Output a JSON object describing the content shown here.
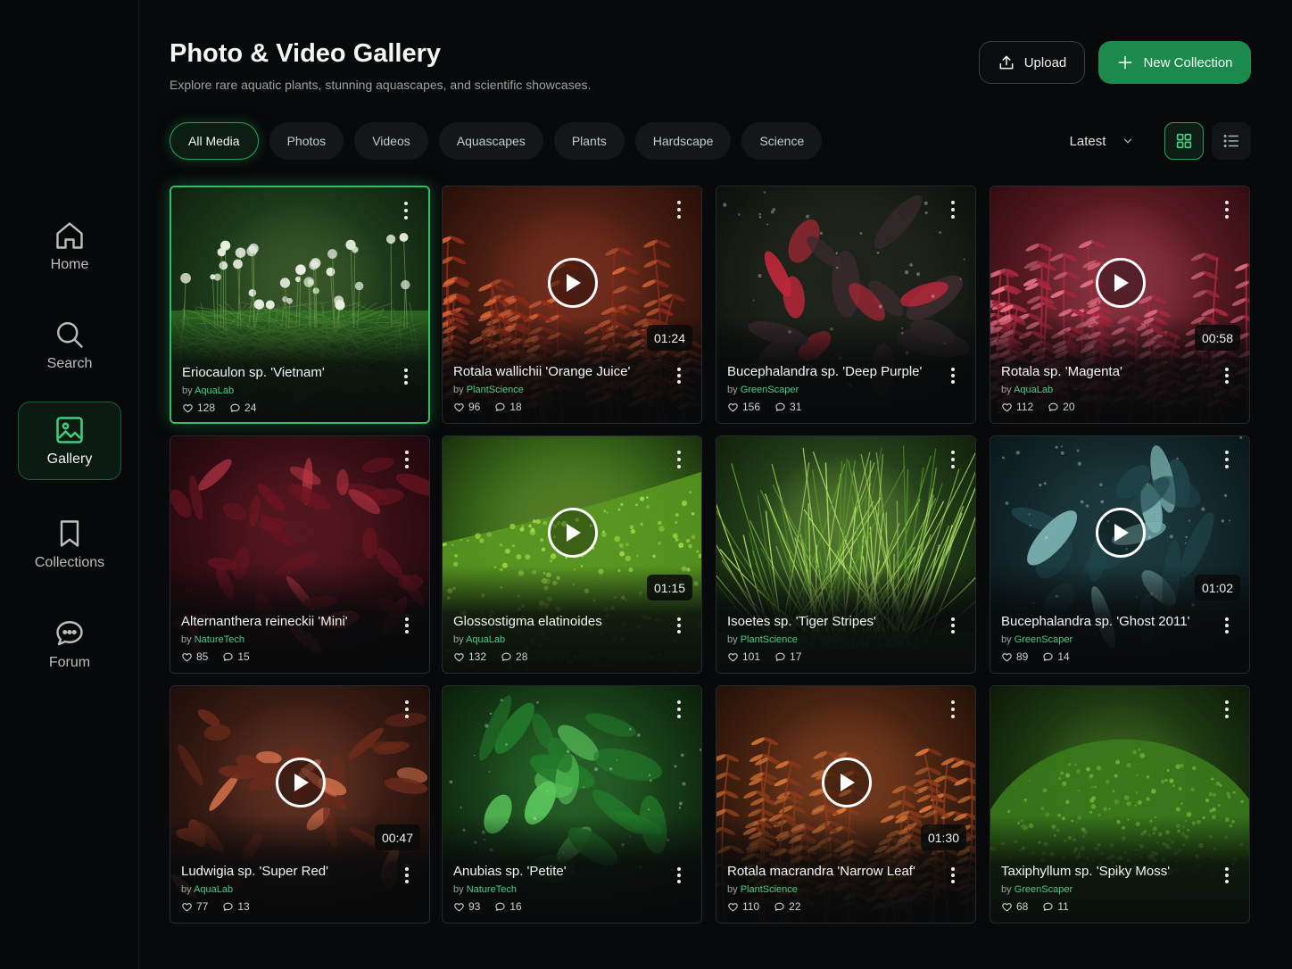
{
  "nav": [
    {
      "label": "Home",
      "icon": "home-icon"
    },
    {
      "label": "Search",
      "icon": "search-icon"
    },
    {
      "label": "Gallery",
      "icon": "image-icon",
      "active": true
    },
    {
      "label": "Collections",
      "icon": "bookmark-icon"
    },
    {
      "label": "Forum",
      "icon": "chat-icon"
    }
  ],
  "header": {
    "title": "Photo & Video Gallery",
    "subtitle": "Explore rare aquatic plants, stunning aquascapes, and scientific showcases.",
    "upload_label": "Upload",
    "new_collection_label": "New Collection"
  },
  "filters": [
    "All Media",
    "Photos",
    "Videos",
    "Aquascapes",
    "Plants",
    "Hardscape",
    "Science"
  ],
  "active_filter": "All Media",
  "sort": {
    "selected": "Latest"
  },
  "view": {
    "selected": "grid"
  },
  "colors": {
    "accent": "#1c8a4c",
    "accent_bright": "#2fc06b",
    "background": "#07090a"
  },
  "items": [
    {
      "title": "Eriocaulon sp. 'Vietnam'",
      "by": "by",
      "author": "AquaLab",
      "likes": "128",
      "comments": "24",
      "video": false,
      "duration": "",
      "selected": true,
      "theme": "eriocaulon"
    },
    {
      "title": "Rotala wallichii 'Orange Juice'",
      "by": "by",
      "author": "PlantScience",
      "likes": "96",
      "comments": "18",
      "video": true,
      "duration": "01:24",
      "theme": "red-stems"
    },
    {
      "title": "Bucephalandra sp. 'Deep Purple'",
      "by": "by",
      "author": "GreenScaper",
      "likes": "156",
      "comments": "31",
      "video": false,
      "duration": "",
      "theme": "buce-dark"
    },
    {
      "title": "Rotala sp. 'Magenta'",
      "by": "by",
      "author": "AquaLab",
      "likes": "112",
      "comments": "20",
      "video": true,
      "duration": "00:58",
      "theme": "magenta"
    },
    {
      "title": "Alternanthera reineckii 'Mini'",
      "by": "by",
      "author": "NatureTech",
      "likes": "85",
      "comments": "15",
      "video": false,
      "duration": "",
      "theme": "alternanthera"
    },
    {
      "title": "Glossostigma elatinoides",
      "by": "by",
      "author": "AquaLab",
      "likes": "132",
      "comments": "28",
      "video": true,
      "duration": "01:15",
      "theme": "carpet"
    },
    {
      "title": "Isoetes sp. 'Tiger Stripes'",
      "by": "by",
      "author": "PlantScience",
      "likes": "101",
      "comments": "17",
      "video": false,
      "duration": "",
      "theme": "grass"
    },
    {
      "title": "Bucephalandra sp. 'Ghost 2011'",
      "by": "by",
      "author": "GreenScaper",
      "likes": "89",
      "comments": "14",
      "video": true,
      "duration": "01:02",
      "theme": "buce-blue"
    },
    {
      "title": "Ludwigia sp. 'Super Red'",
      "by": "by",
      "author": "AquaLab",
      "likes": "77",
      "comments": "13",
      "video": true,
      "duration": "00:47",
      "theme": "ludwigia"
    },
    {
      "title": "Anubias sp. 'Petite'",
      "by": "by",
      "author": "NatureTech",
      "likes": "93",
      "comments": "16",
      "video": false,
      "duration": "",
      "theme": "anubias"
    },
    {
      "title": "Rotala macrandra 'Narrow Leaf'",
      "by": "by",
      "author": "PlantScience",
      "likes": "110",
      "comments": "22",
      "video": true,
      "duration": "01:30",
      "theme": "macrandra"
    },
    {
      "title": "Taxiphyllum sp. 'Spiky Moss'",
      "by": "by",
      "author": "GreenScaper",
      "likes": "68",
      "comments": "11",
      "video": false,
      "duration": "",
      "theme": "moss"
    }
  ]
}
